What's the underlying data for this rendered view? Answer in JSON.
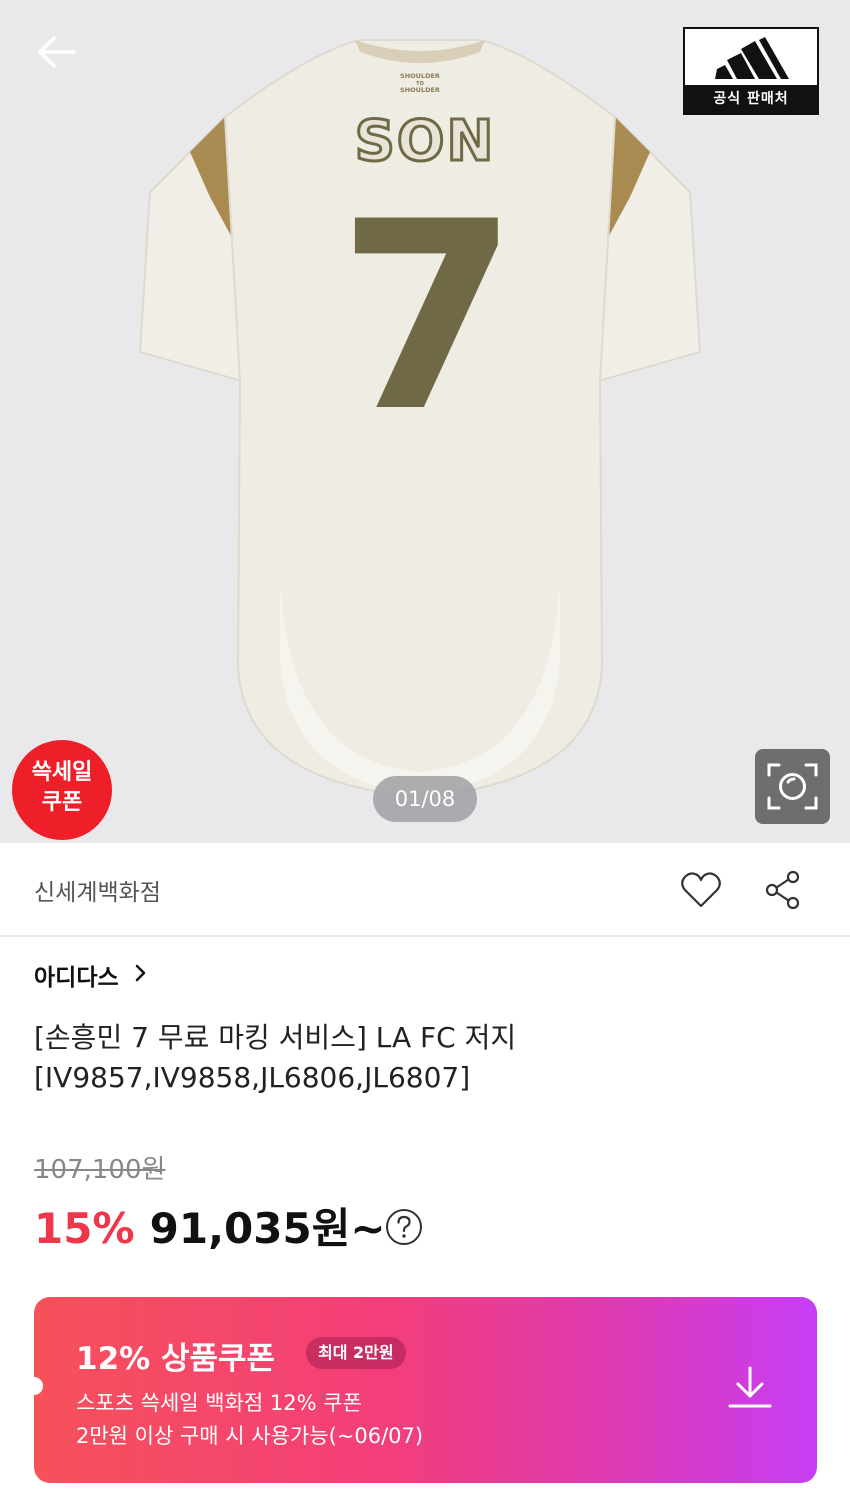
{
  "hero": {
    "official_badge": "공식 판매처",
    "sale_badge_line1": "쓱세일",
    "sale_badge_line2": "쿠폰",
    "page_counter": "01/08",
    "jersey_name": "SON",
    "jersey_number": "7",
    "jersey_tag_line1": "SHOULDER",
    "jersey_tag_line2": "TO",
    "jersey_tag_line3": "SHOULDER"
  },
  "seller": {
    "name": "신세계백화점"
  },
  "product": {
    "brand": "아디다스",
    "title_line1": "[손흥민 7 무료 마킹 서비스] LA FC 저지",
    "title_line2": "[IV9857,IV9858,JL6806,JL6807]",
    "original_price": "107,100원",
    "discount_rate": "15%",
    "sale_price": "91,035원~"
  },
  "coupon": {
    "title": "12% 상품쿠폰",
    "max_badge": "최대 2만원",
    "desc_line1": "스포츠 쓱세일 백화점 12% 쿠폰",
    "desc_line2": "2만원 이상 구매 시 사용가능(~06/07)"
  },
  "colors": {
    "hero_bg": "#e9e9eb",
    "sale_red": "#ef1f2a",
    "discount_red": "#f0364a",
    "coupon_gradient_start": "#f7515a",
    "coupon_gradient_end": "#c63ef5",
    "jersey_cream": "#efece4",
    "jersey_gold": "#a98b52",
    "jersey_olive": "#6f6a45"
  },
  "icons": {
    "back": "arrow-left-icon",
    "brand_logo": "adidas-logo",
    "lens": "camera-search-icon",
    "heart": "heart-icon",
    "share": "share-icon",
    "chevron": "chevron-right-icon",
    "help": "question-circle-icon",
    "download": "download-icon"
  }
}
